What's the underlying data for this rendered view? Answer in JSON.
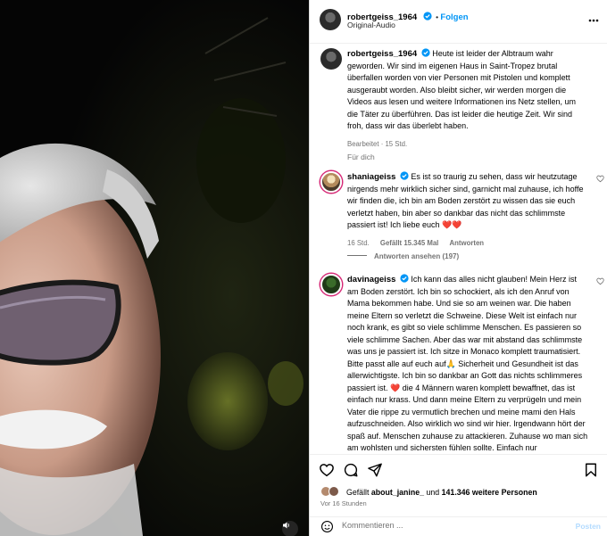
{
  "header": {
    "username": "robertgeiss_1964",
    "follow_label": "Folgen",
    "subtitle": "Original-Audio",
    "more_icon": "more-horizontal-icon"
  },
  "caption": {
    "username": "robertgeiss_1964",
    "text": "Heute ist leider der Albtraum wahr geworden. Wir sind im eigenen Haus in Saint-Tropez brutal überfallen worden von vier Personen mit Pistolen und komplett ausgeraubt worden. Also bleibt sicher, wir werden morgen die Videos aus lesen und weitere Informationen ins Netz stellen, um die Täter zu überführen. Das ist leider die heutige Zeit. Wir sind froh, dass wir das überlebt haben.",
    "meta": "Bearbeitet · 15 Std.",
    "translate": "Für dich"
  },
  "comments": [
    {
      "username": "shaniageiss",
      "text": "Es ist so traurig zu sehen, dass wir heutzutage nirgends mehr wirklich sicher sind, garnicht mal zuhause, ich hoffe wir finden die, ich bin am Boden zerstört zu wissen das sie euch verletzt haben, bin aber so dankbar das nicht das schlimmste passiert ist! Ich liebe euch ❤️❤️",
      "time": "16 Std.",
      "likes": "Gefällt 15.345 Mal",
      "reply": "Antworten",
      "view_replies": "Antworten ansehen (197)"
    },
    {
      "username": "davinageiss",
      "text": "Ich kann das alles nicht glauben! Mein Herz ist am Boden zerstört. Ich bin so schockiert, als ich den Anruf von Mama bekommen habe. Und sie so am weinen war. Die haben meine Eltern so verletzt die Schweine. Diese Welt ist einfach nur noch krank, es gibt so viele schlimme Menschen. Es passieren so viele schlimme Sachen. Aber das war mit abstand das schlimmste was uns je passiert ist. Ich sitze in Monaco komplett traumatisiert. Bitte passt alle auf euch auf🙏 Sicherheit und Gesundheit ist das allerwichtigste. Ich bin so dankbar an Gott das nichts schlimmeres passiert ist. ❤️ die 4 Männern waren komplett bewaffnet, das ist einfach nur krass. Und dann meine Eltern zu verprügeln und mein Vater die rippe zu vermutlich brechen und meine mami den Hals aufzuschneiden. Also wirklich wo sind wir hier. Irgendwann hört der spaß auf. Menschen zuhause zu attackieren. Zuhause wo man sich am wohlsten und sichersten fühlen sollte. Einfach nur"
    }
  ],
  "actions": {
    "like_icon": "heart-icon",
    "comment_icon": "comment-icon",
    "share_icon": "send-icon",
    "save_icon": "bookmark-icon",
    "likes_prefix": "Gefällt",
    "likes_user": "about_janine_",
    "likes_connector": "und",
    "likes_count": "141.346 weitere Personen",
    "time": "Vor 16 Stunden"
  },
  "compose": {
    "placeholder": "Kommentieren ...",
    "post_label": "Posten",
    "emoji_icon": "smiley-icon"
  },
  "video": {
    "mute_icon": "speaker-icon"
  },
  "colors": {
    "accent": "#0095f6",
    "heart": "#ed4956",
    "muted_text": "#737373"
  }
}
